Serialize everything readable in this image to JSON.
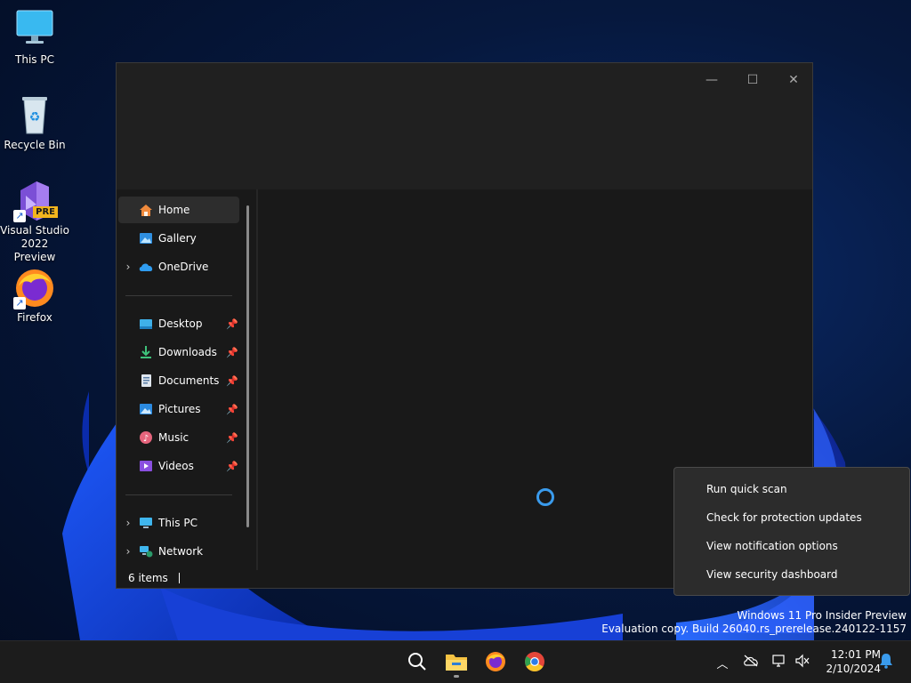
{
  "desktop": {
    "icons": [
      {
        "label": "This PC",
        "icon": "monitor-icon"
      },
      {
        "label": "Recycle Bin",
        "icon": "recycle-bin-icon"
      },
      {
        "label": "Visual Studio 2022 Preview",
        "icon": "visual-studio-icon",
        "badge": "PRE"
      },
      {
        "label": "Firefox",
        "icon": "firefox-icon"
      }
    ]
  },
  "explorer": {
    "controls": {
      "minimize": "—",
      "maximize": "☐",
      "close": "✕"
    },
    "nav": {
      "top": [
        {
          "label": "Home",
          "icon": "home-icon",
          "active": true
        },
        {
          "label": "Gallery",
          "icon": "gallery-icon"
        },
        {
          "label": "OneDrive",
          "icon": "onedrive-icon",
          "expandable": true
        }
      ],
      "quick_access": [
        {
          "label": "Desktop",
          "icon": "desktop-folder-icon"
        },
        {
          "label": "Downloads",
          "icon": "downloads-icon"
        },
        {
          "label": "Documents",
          "icon": "documents-icon"
        },
        {
          "label": "Pictures",
          "icon": "pictures-icon"
        },
        {
          "label": "Music",
          "icon": "music-icon"
        },
        {
          "label": "Videos",
          "icon": "videos-icon"
        }
      ],
      "locations": [
        {
          "label": "This PC",
          "icon": "this-pc-icon",
          "expandable": true
        },
        {
          "label": "Network",
          "icon": "network-icon",
          "expandable": true
        }
      ]
    },
    "status": {
      "items": "6 items"
    }
  },
  "context_menu": {
    "items": [
      "Run quick scan",
      "Check for protection updates",
      "View notification options",
      "View security dashboard"
    ]
  },
  "watermark": {
    "line1": "Windows 11 Pro Insider Preview",
    "line2": "Evaluation copy. Build 26040.rs_prerelease.240122-1157"
  },
  "taskbar": {
    "apps": [
      "search-icon",
      "file-explorer-icon",
      "firefox-icon",
      "chrome-icon"
    ],
    "clock": {
      "time": "12:01 PM",
      "date": "2/10/2024"
    }
  },
  "colors": {
    "accent": "#3a9bec",
    "window_bg": "#191919",
    "titlebar_bg": "#202020"
  }
}
